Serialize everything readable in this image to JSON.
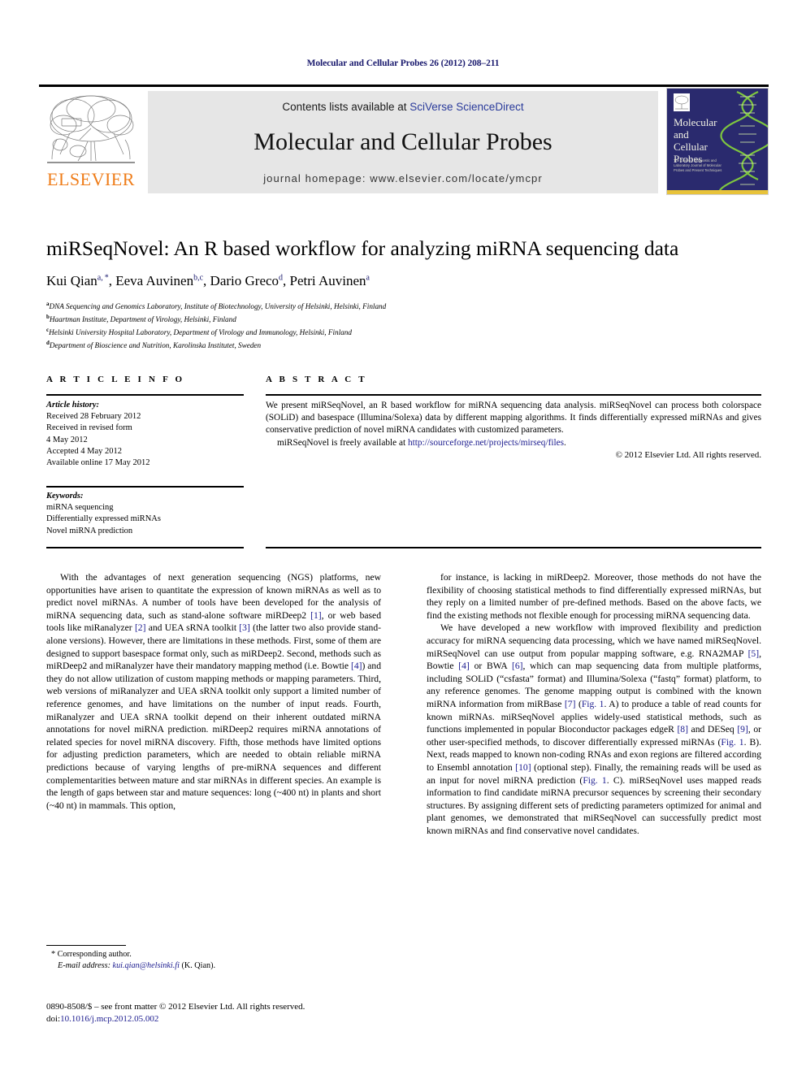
{
  "running_head": "Molecular and Cellular Probes 26 (2012) 208–211",
  "masthead": {
    "contents_prefix": "Contents lists available at ",
    "contents_link": "SciVerse ScienceDirect",
    "journal_title": "Molecular and Cellular Probes",
    "homepage": "journal homepage: www.elsevier.com/locate/ymcpr",
    "publisher_name": "ELSEVIER",
    "cover": {
      "title_line1": "Molecular",
      "title_line2": "and",
      "title_line3": "Cellular",
      "title_line4": "Probes",
      "subtitle": "The Genetic, Diagnostic and Laboratory Journal of Molecular Probes and Present Techniques"
    }
  },
  "article": {
    "title": "miRSeqNovel: An R based workflow for analyzing miRNA sequencing data",
    "authors_html": "Kui Qian<sup>a, *</sup>, Eeva Auvinen<sup>b,c</sup>, Dario Greco<sup>d</sup>, Petri Auvinen<sup>a</sup>",
    "affiliations": [
      {
        "marker": "a",
        "text": "DNA Sequencing and Genomics Laboratory, Institute of Biotechnology, University of Helsinki, Helsinki, Finland"
      },
      {
        "marker": "b",
        "text": "Haartman Institute, Department of Virology, Helsinki, Finland"
      },
      {
        "marker": "c",
        "text": "Helsinki University Hospital Laboratory, Department of Virology and Immunology, Helsinki, Finland"
      },
      {
        "marker": "d",
        "text": "Department of Bioscience and Nutrition, Karolinska Institutet, Sweden"
      }
    ]
  },
  "info": {
    "heading": "A R T I C L E   I N F O",
    "history_label": "Article history:",
    "history": [
      "Received 28 February 2012",
      "Received in revised form",
      "4 May 2012",
      "Accepted 4 May 2012",
      "Available online 17 May 2012"
    ],
    "keywords_label": "Keywords:",
    "keywords": [
      "miRNA sequencing",
      "Differentially expressed miRNAs",
      "Novel miRNA prediction"
    ]
  },
  "abstract": {
    "heading": "A B S T R A C T",
    "paragraph1": "We present miRSeqNovel, an R based workflow for miRNA sequencing data analysis. miRSeqNovel can process both colorspace (SOLiD) and basespace (Illumina/Solexa) data by different mapping algorithms. It finds differentially expressed miRNAs and gives conservative prediction of novel miRNA candidates with customized parameters.",
    "paragraph2_prefix": "miRSeqNovel is freely available at ",
    "paragraph2_link": "http://sourceforge.net/projects/mirseq/files",
    "paragraph2_suffix": ".",
    "copyright": "© 2012 Elsevier Ltd. All rights reserved."
  },
  "body": {
    "left_column_html": "With the advantages of next generation sequencing (NGS) platforms, new opportunities have arisen to quantitate the expression of known miRNAs as well as to predict novel miRNAs. A number of tools have been developed for the analysis of miRNA sequencing data, such as stand-alone software miRDeep2 <span class=\"ref\">[1]</span>, or web based tools like miRanalyzer <span class=\"ref\">[2]</span> and UEA sRNA toolkit <span class=\"ref\">[3]</span> (the latter two also provide stand-alone versions). However, there are limitations in these methods. First, some of them are designed to support basespace format only, such as miRDeep2. Second, methods such as miRDeep2 and miRanalyzer have their mandatory mapping method (i.e. Bowtie <span class=\"ref\">[4]</span>) and they do not allow utilization of custom mapping methods or mapping parameters. Third, web versions of miRanalyzer and UEA sRNA toolkit only support a limited number of reference genomes, and have limitations on the number of input reads. Fourth, miRanalyzer and UEA sRNA toolkit depend on their inherent outdated miRNA annotations for novel miRNA prediction. miRDeep2 requires miRNA annotations of related species for novel miRNA discovery. Fifth, those methods have limited options for adjusting prediction parameters, which are needed to obtain reliable miRNA predictions because of varying lengths of pre-miRNA sequences and different complementarities between mature and star miRNAs in different species. An example is the length of gaps between star and mature sequences: long (~400 nt) in plants and short (~40 nt) in mammals. This option,",
    "right_column_p1_html": "for instance, is lacking in miRDeep2. Moreover, those methods do not have the flexibility of choosing statistical methods to find differentially expressed miRNAs, but they reply on a limited number of pre-defined methods. Based on the above facts, we find the existing methods not flexible enough for processing miRNA sequencing data.",
    "right_column_p2_html": "We have developed a new workflow with improved flexibility and prediction accuracy for miRNA sequencing data processing, which we have named miRSeqNovel. miRSeqNovel can use output from popular mapping software, e.g. RNA2MAP <span class=\"ref\">[5]</span>, Bowtie <span class=\"ref\">[4]</span> or BWA <span class=\"ref\">[6]</span>, which can map sequencing data from multiple platforms, including SOLiD (“csfasta” format) and Illumina/Solexa (“fastq” format) platform, to any reference genomes. The genome mapping output is combined with the known miRNA information from miRBase <span class=\"ref\">[7]</span> (<span class=\"ref\">Fig. 1</span>. A) to produce a table of read counts for known miRNAs. miRSeqNovel applies widely-used statistical methods, such as functions implemented in popular Bioconductor packages edgeR <span class=\"ref\">[8]</span> and DESeq <span class=\"ref\">[9]</span>, or other user-specified methods, to discover differentially expressed miRNAs (<span class=\"ref\">Fig. 1</span>. B). Next, reads mapped to known non-coding RNAs and exon regions are filtered according to Ensembl annotation <span class=\"ref\">[10]</span> (optional step). Finally, the remaining reads will be used as an input for novel miRNA prediction (<span class=\"ref\">Fig. 1</span>. C). miRSeqNovel uses mapped reads information to find candidate miRNA precursor sequences by screening their secondary structures. By assigning different sets of predicting parameters optimized for animal and plant genomes, we demonstrated that miRSeqNovel can successfully predict most known miRNAs and find conservative novel candidates."
  },
  "footer": {
    "corresponding_author": "* Corresponding author.",
    "email_label": "E-mail address:",
    "email": "kui.qian@helsinki.fi",
    "email_owner": "(K. Qian).",
    "issn_line": "0890-8508/$ – see front matter © 2012 Elsevier Ltd. All rights reserved.",
    "doi_label": "doi:",
    "doi": "10.1016/j.mcp.2012.05.002"
  }
}
